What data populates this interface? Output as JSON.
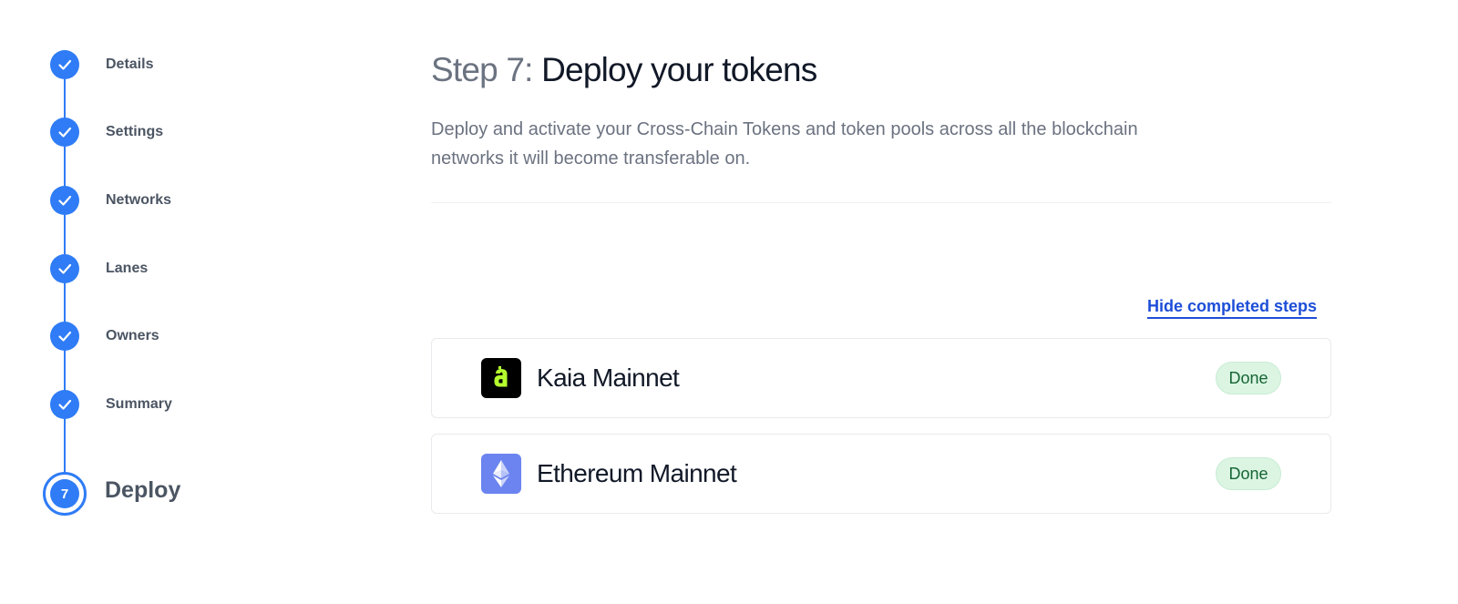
{
  "stepper": {
    "steps": [
      {
        "label": "Details"
      },
      {
        "label": "Settings"
      },
      {
        "label": "Networks"
      },
      {
        "label": "Lanes"
      },
      {
        "label": "Owners"
      },
      {
        "label": "Summary"
      }
    ],
    "current": {
      "number": "7",
      "label": "Deploy"
    },
    "accent_color": "#2f7cf6"
  },
  "header": {
    "step_prefix": "Step 7:",
    "title": "Deploy your tokens",
    "description": "Deploy and activate your Cross-Chain Tokens and token pools across all the blockchain networks it will become transferable on."
  },
  "actions": {
    "hide_completed": "Hide completed steps"
  },
  "networks": [
    {
      "name": "Kaia Mainnet",
      "status": "Done",
      "icon": "kaia-logo-icon",
      "logo_color": "#000000"
    },
    {
      "name": "Ethereum Mainnet",
      "status": "Done",
      "icon": "ethereum-logo-icon",
      "logo_color": "#6b84f0"
    }
  ]
}
